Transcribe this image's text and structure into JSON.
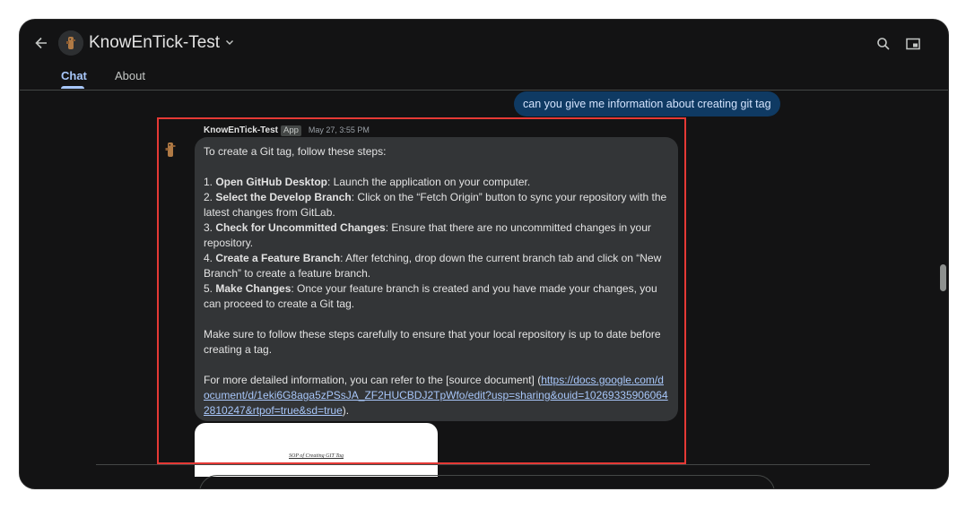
{
  "header": {
    "title": "KnowEnTick-Test",
    "icons": [
      "arrow-back-icon",
      "chevron-down-icon",
      "search-icon",
      "picture-in-picture-icon"
    ]
  },
  "tabs": [
    {
      "label": "Chat",
      "active": true
    },
    {
      "label": "About",
      "active": false
    }
  ],
  "user_message": "can you give me information about creating git tag",
  "bot_message": {
    "sender": "KnowEnTick-Test",
    "badge": "App",
    "time": "May 27, 3:55 PM",
    "intro": "To create a Git tag, follow these steps:",
    "steps": [
      {
        "num": "1. ",
        "bold": "Open GitHub Desktop",
        "text": ": Launch the application on your computer."
      },
      {
        "num": "2. ",
        "bold": "Select the Develop Branch",
        "text": ": Click on the “Fetch Origin” button to sync your repository with the latest changes from GitLab."
      },
      {
        "num": "3. ",
        "bold": "Check for Uncommitted Changes",
        "text": ": Ensure that there are no uncommitted changes in your repository."
      },
      {
        "num": "4. ",
        "bold": "Create a Feature Branch",
        "text": ": After fetching, drop down the current branch tab and click on “New Branch” to create a feature branch."
      },
      {
        "num": "5. ",
        "bold": "Make Changes",
        "text": ": Once your feature branch is created and you have made your changes, you can proceed to create a Git tag."
      }
    ],
    "outro": "Make sure to follow these steps carefully to ensure that your local repository is up to date before creating a tag.",
    "source_prefix": "For more detailed information, you can refer to the [source document] (",
    "source_url": "https://docs.google.com/document/d/1eki6G8aga5zPSsJA_ZF2HUCBDJ2TpWfo/edit?usp=sharing&ouid=102693359060642810247&rtpof=true&sd=true",
    "source_suffix": ").",
    "attachment_title": "SOP of Creating GIT Tag"
  },
  "colors": {
    "background": "#131314",
    "bot_bubble": "#333537",
    "user_bubble": "#0f3a63",
    "accent": "#a8c7fa",
    "highlight": "#e53935"
  }
}
